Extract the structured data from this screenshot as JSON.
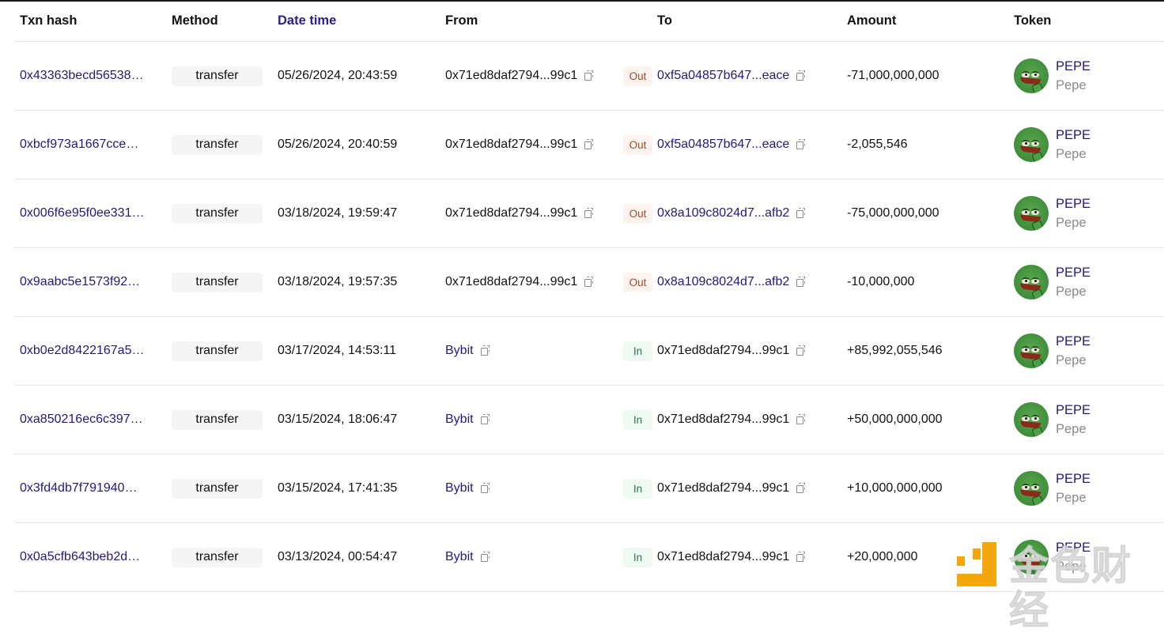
{
  "table": {
    "columns": [
      {
        "key": "hash",
        "label": "Txn hash",
        "sorted": false
      },
      {
        "key": "method",
        "label": "Method",
        "sorted": false
      },
      {
        "key": "datetime",
        "label": "Date time",
        "sorted": true
      },
      {
        "key": "from",
        "label": "From",
        "sorted": false
      },
      {
        "key": "to",
        "label": "To",
        "sorted": false
      },
      {
        "key": "amount",
        "label": "Amount",
        "sorted": false
      },
      {
        "key": "token",
        "label": "Token",
        "sorted": false
      }
    ],
    "rows": [
      {
        "hash": "0x43363becd56538…",
        "method": "transfer",
        "datetime": "05/26/2024, 20:43:59",
        "from": "0x71ed8daf2794...99c1",
        "from_is_link": false,
        "direction": "Out",
        "to": "0xf5a04857b647...eace",
        "to_is_link": true,
        "amount": "-71,000,000,000",
        "token_symbol": "PEPE",
        "token_name": "Pepe"
      },
      {
        "hash": "0xbcf973a1667cce…",
        "method": "transfer",
        "datetime": "05/26/2024, 20:40:59",
        "from": "0x71ed8daf2794...99c1",
        "from_is_link": false,
        "direction": "Out",
        "to": "0xf5a04857b647...eace",
        "to_is_link": true,
        "amount": "-2,055,546",
        "token_symbol": "PEPE",
        "token_name": "Pepe"
      },
      {
        "hash": "0x006f6e95f0ee331…",
        "method": "transfer",
        "datetime": "03/18/2024, 19:59:47",
        "from": "0x71ed8daf2794...99c1",
        "from_is_link": false,
        "direction": "Out",
        "to": "0x8a109c8024d7...afb2",
        "to_is_link": true,
        "amount": "-75,000,000,000",
        "token_symbol": "PEPE",
        "token_name": "Pepe"
      },
      {
        "hash": "0x9aabc5e1573f92…",
        "method": "transfer",
        "datetime": "03/18/2024, 19:57:35",
        "from": "0x71ed8daf2794...99c1",
        "from_is_link": false,
        "direction": "Out",
        "to": "0x8a109c8024d7...afb2",
        "to_is_link": true,
        "amount": "-10,000,000",
        "token_symbol": "PEPE",
        "token_name": "Pepe"
      },
      {
        "hash": "0xb0e2d8422167a5…",
        "method": "transfer",
        "datetime": "03/17/2024, 14:53:11",
        "from": "Bybit",
        "from_is_link": true,
        "direction": "In",
        "to": "0x71ed8daf2794...99c1",
        "to_is_link": false,
        "amount": "+85,992,055,546",
        "token_symbol": "PEPE",
        "token_name": "Pepe"
      },
      {
        "hash": "0xa850216ec6c397…",
        "method": "transfer",
        "datetime": "03/15/2024, 18:06:47",
        "from": "Bybit",
        "from_is_link": true,
        "direction": "In",
        "to": "0x71ed8daf2794...99c1",
        "to_is_link": false,
        "amount": "+50,000,000,000",
        "token_symbol": "PEPE",
        "token_name": "Pepe"
      },
      {
        "hash": "0x3fd4db7f791940…",
        "method": "transfer",
        "datetime": "03/15/2024, 17:41:35",
        "from": "Bybit",
        "from_is_link": true,
        "direction": "In",
        "to": "0x71ed8daf2794...99c1",
        "to_is_link": false,
        "amount": "+10,000,000,000",
        "token_symbol": "PEPE",
        "token_name": "Pepe"
      },
      {
        "hash": "0x0a5cfb643beb2d…",
        "method": "transfer",
        "datetime": "03/13/2024, 00:54:47",
        "from": "Bybit",
        "from_is_link": true,
        "direction": "In",
        "to": "0x71ed8daf2794...99c1",
        "to_is_link": false,
        "amount": "+20,000,000",
        "token_symbol": "PEPE",
        "token_name": "Pepe"
      }
    ]
  },
  "icons": {
    "copy": "copy-icon",
    "token_logo": "pepe-token-logo"
  },
  "colors": {
    "link": "#221a7e",
    "out_badge_text": "#a14a2a",
    "out_badge_bg": "#fdf4f0",
    "in_badge_text": "#2a7a4a",
    "in_badge_bg": "#eefaf2",
    "watermark_logo": "#f4a60f"
  },
  "watermark": {
    "text": "金色财经"
  }
}
